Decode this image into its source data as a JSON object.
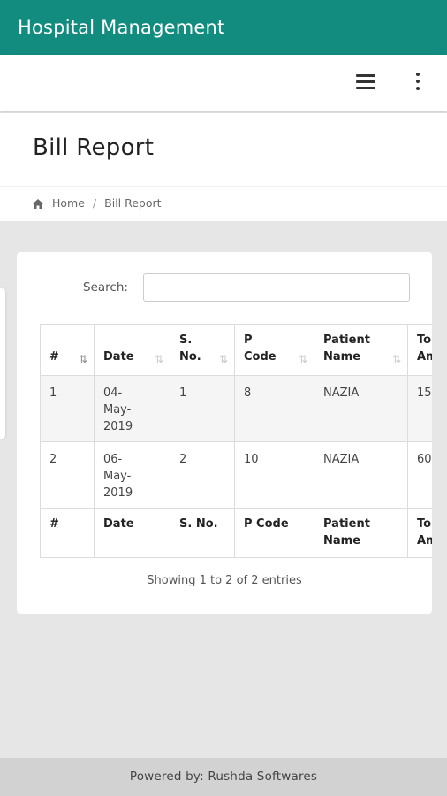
{
  "app": {
    "title": "Hospital Management"
  },
  "toolbar": {
    "menu_icon": "hamburger-menu-icon",
    "more_icon": "more-vertical-icon"
  },
  "page": {
    "title": "Bill Report"
  },
  "breadcrumb": {
    "home_icon": "home-icon",
    "home": "Home",
    "current": "Bill Report",
    "divider": "/"
  },
  "search": {
    "label": "Search:",
    "value": "",
    "placeholder": ""
  },
  "table": {
    "headers": [
      {
        "line1": "#",
        "line2": ""
      },
      {
        "line1": "Date",
        "line2": ""
      },
      {
        "line1": "S.",
        "line2": "No."
      },
      {
        "line1": "P",
        "line2": "Code"
      },
      {
        "line1": "Patient",
        "line2": "Name"
      },
      {
        "line1": "To",
        "line2": "Am"
      }
    ],
    "rows": [
      {
        "num": "1",
        "date_l1": "04-",
        "date_l2": "May-",
        "date_l3": "2019",
        "sno": "1",
        "pcode": "8",
        "patient": "NAZIA",
        "total": "15"
      },
      {
        "num": "2",
        "date_l1": "06-",
        "date_l2": "May-",
        "date_l3": "2019",
        "sno": "2",
        "pcode": "10",
        "patient": "NAZIA",
        "total": "60"
      }
    ],
    "footer": [
      {
        "line1": "#",
        "line2": ""
      },
      {
        "line1": "Date",
        "line2": ""
      },
      {
        "line1": "S. No.",
        "line2": ""
      },
      {
        "line1": "P Code",
        "line2": ""
      },
      {
        "line1": "Patient",
        "line2": "Name"
      },
      {
        "line1": "To",
        "line2": "Am"
      }
    ]
  },
  "info": "Showing 1 to 2 of 2 entries",
  "footer": "Powered by: Rushda Softwares"
}
